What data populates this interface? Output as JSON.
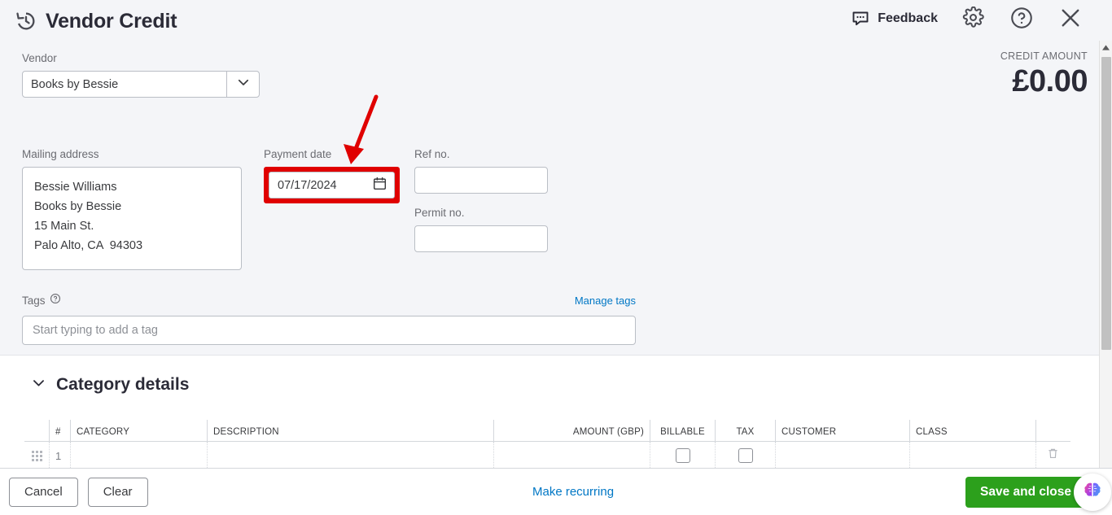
{
  "header": {
    "title": "Vendor Credit",
    "history_icon": "history-clock-icon",
    "feedback_label": "Feedback",
    "gear_icon": "gear-icon",
    "help_icon": "help-circle-icon",
    "close_icon": "close-x-icon"
  },
  "credit": {
    "label": "CREDIT AMOUNT",
    "value": "£0.00"
  },
  "form": {
    "vendor_label": "Vendor",
    "vendor_value": "Books by Bessie",
    "vendor_caret_icon": "chevron-down-icon",
    "mailing_label": "Mailing address",
    "mailing_value": "Bessie Williams\nBooks by Bessie\n15 Main St.\nPalo Alto, CA  94303",
    "payment_date_label": "Payment date",
    "payment_date_value": "07/17/2024",
    "calendar_icon": "calendar-icon",
    "ref_label": "Ref no.",
    "ref_value": "",
    "permit_label": "Permit no.",
    "permit_value": ""
  },
  "tags": {
    "label": "Tags",
    "help_icon": "help-circle-icon",
    "manage_link": "Manage tags",
    "placeholder": "Start typing to add a tag",
    "value": ""
  },
  "category_details": {
    "section_title": "Category details",
    "collapse_icon": "chevron-down-icon",
    "columns": [
      "#",
      "CATEGORY",
      "DESCRIPTION",
      "AMOUNT (GBP)",
      "BILLABLE",
      "TAX",
      "CUSTOMER",
      "CLASS"
    ],
    "rows": [
      {
        "num": "1",
        "category": "",
        "description": "",
        "amount": "",
        "billable": false,
        "tax": false,
        "customer": "",
        "class": "",
        "drag_icon": "drag-handle-icon",
        "delete_icon": "trash-icon"
      }
    ]
  },
  "footer": {
    "cancel_label": "Cancel",
    "clear_label": "Clear",
    "make_recurring_label": "Make recurring",
    "save_label": "Save and close",
    "ai_icon": "ai-brain-icon"
  },
  "annotation": {
    "type": "arrow",
    "color": "#e00000",
    "target": "payment-date-field"
  },
  "colors": {
    "background": "#f4f5f8",
    "panel": "#ffffff",
    "accent_link": "#0077c5",
    "save_green": "#2ca01c",
    "annotation_red": "#e00000",
    "text_primary": "#393a3d",
    "text_muted": "#6b6c72"
  }
}
